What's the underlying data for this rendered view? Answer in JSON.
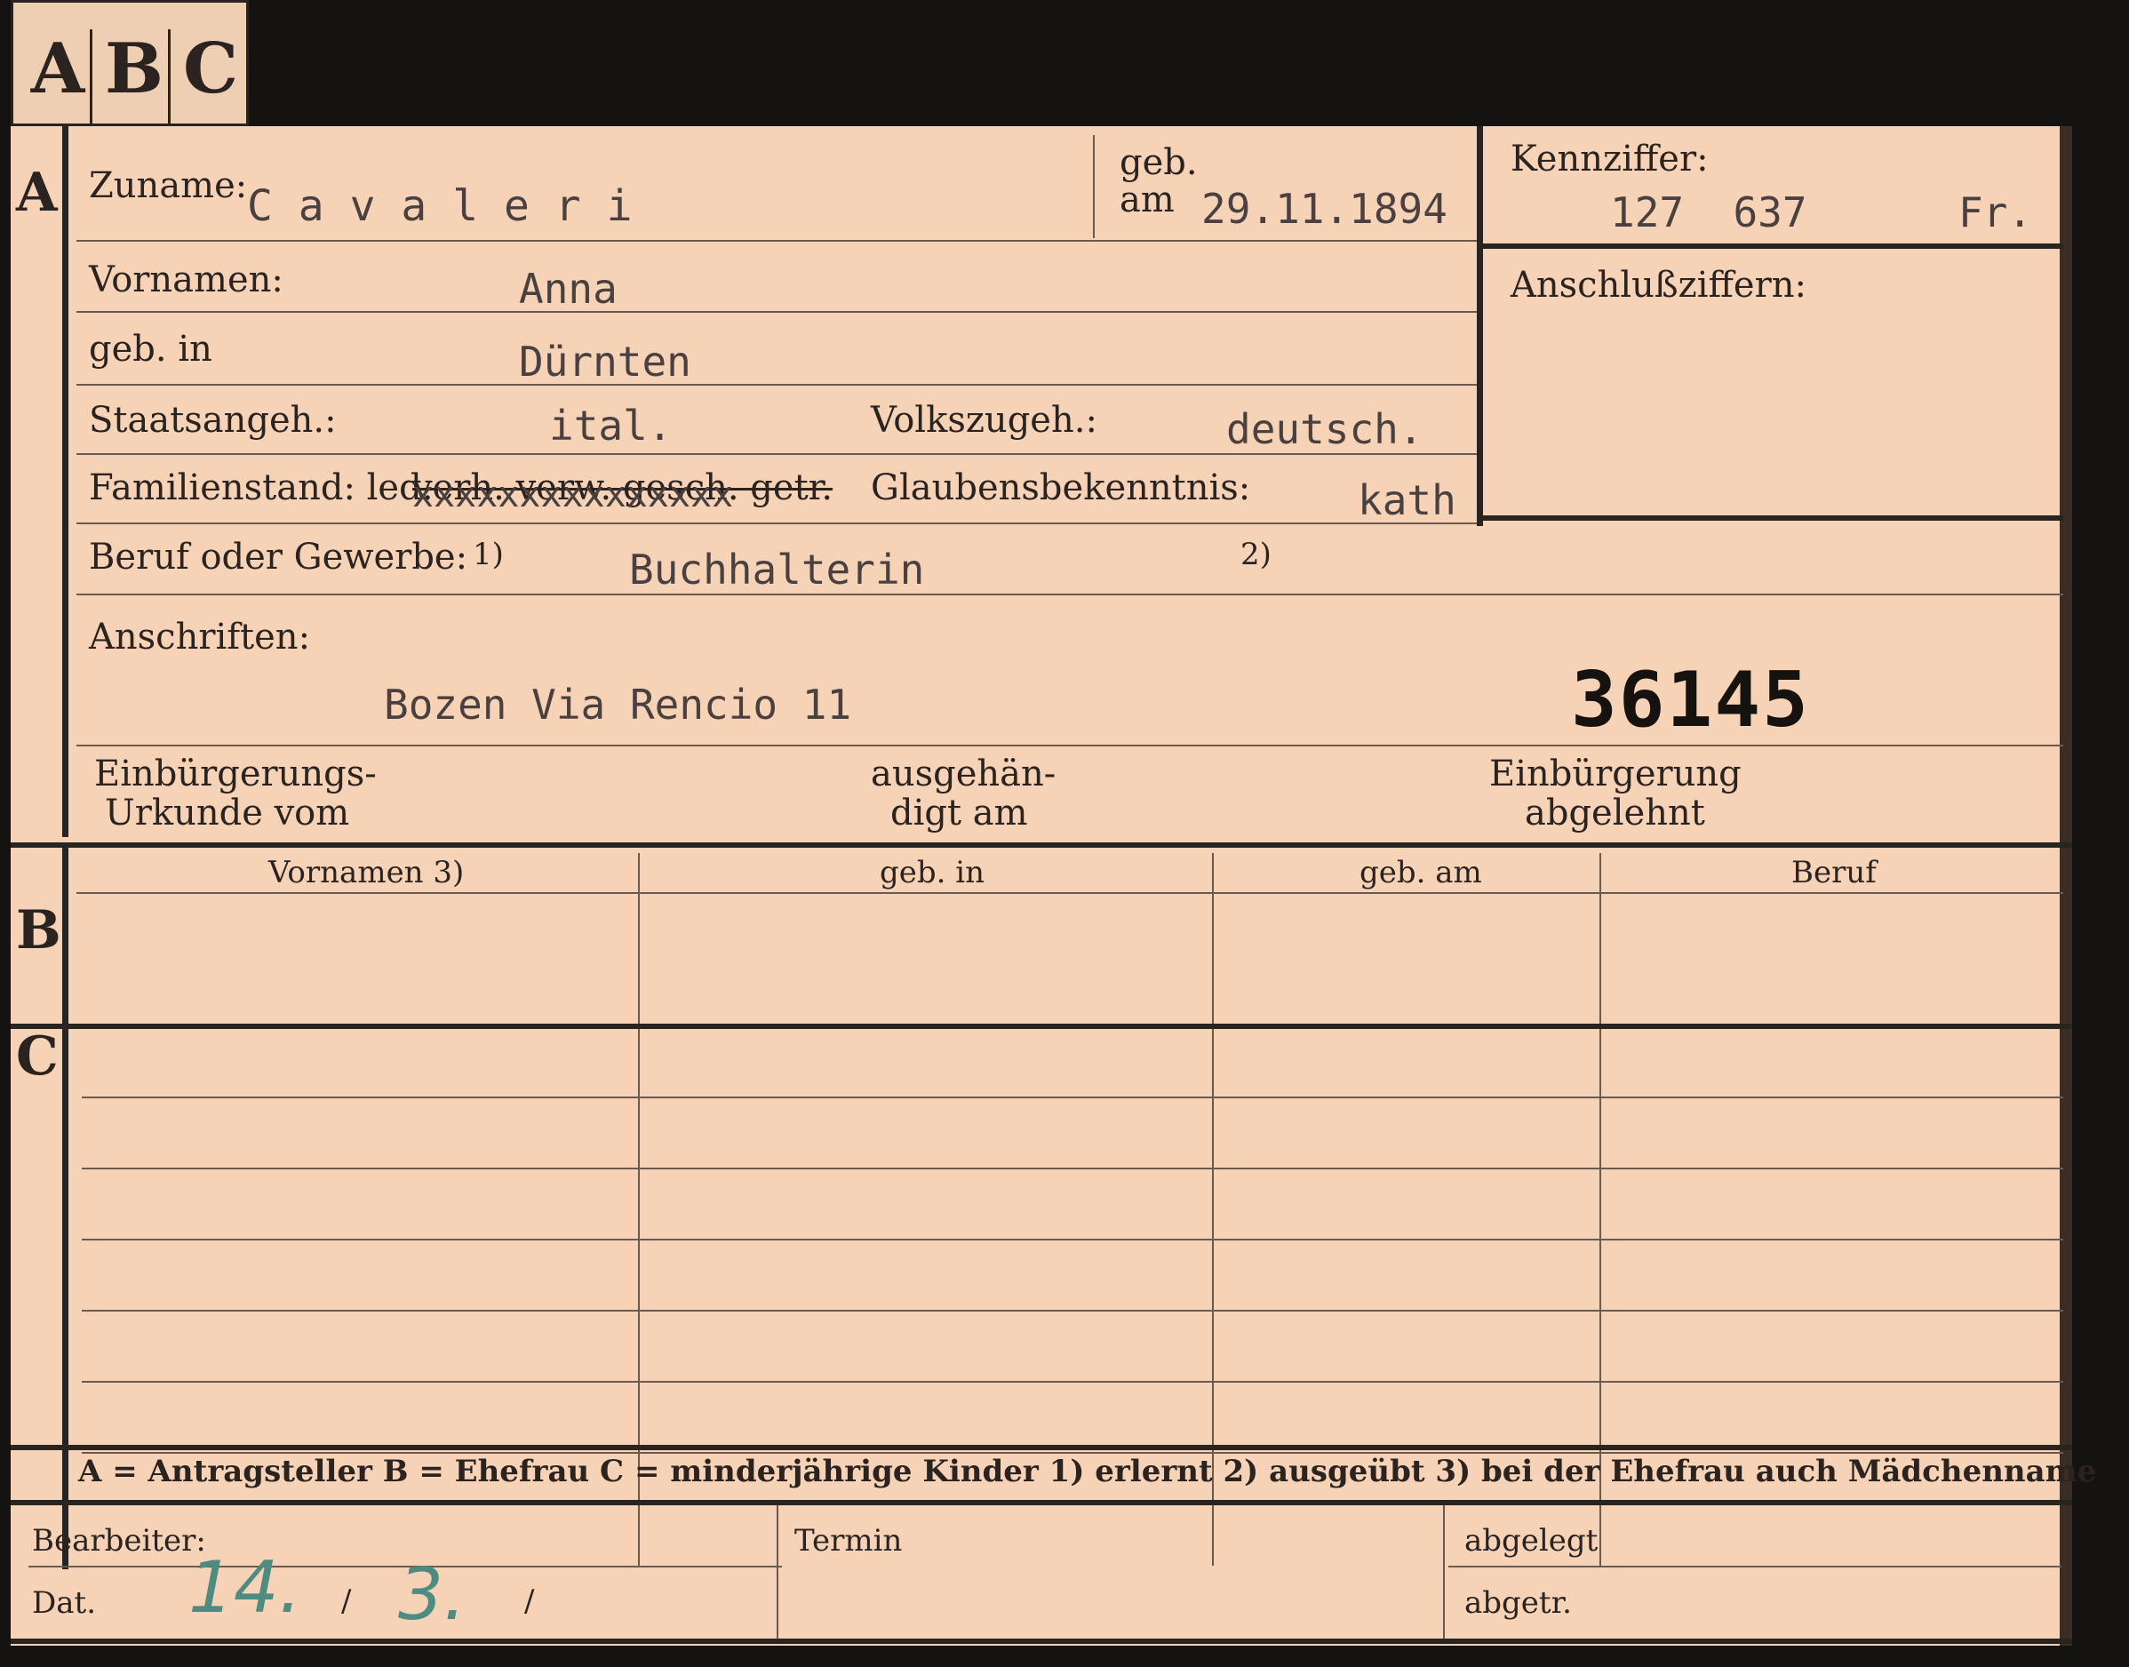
{
  "tabs": [
    "A",
    "B",
    "C"
  ],
  "section_a": {
    "marker": "A",
    "zuname_label": "Zuname:",
    "zuname_value": "C a v a l e r i",
    "geb_label": "geb.",
    "am_label": "am",
    "geb_am_value": "29.11.1894",
    "kennziffer_label": "Kennziffer:",
    "kennziffer_number": "127  637",
    "kennziffer_suffix": "Fr.",
    "anschluss_label": "Anschlußziffern:",
    "vornamen_label": "Vornamen:",
    "vornamen_value": "Anna",
    "gebin_label": "geb. in",
    "gebin_value": "Dürnten",
    "staats_label": "Staatsangeh.:",
    "staats_value": "ital.",
    "volks_label": "Volkszugeh.:",
    "volks_value": "deutsch.",
    "familien_label": "Familienstand: led.",
    "familien_struck": "verh. verw. gesch. getr.",
    "familien_x": "xxxxxxxxxxxxxxx",
    "glauben_label": "Glaubensbekenntnis:",
    "glauben_value": "kath",
    "beruf_label": "Beruf oder Gewerbe:",
    "beruf_note1": "1)",
    "beruf_value": "Buchhalterin",
    "beruf_note2": "2)",
    "anschriften_label": "Anschriften:",
    "anschriften_value": "Bozen Via Rencio 11",
    "stamp_number": "36145",
    "einb_label_1": "Einbürgerungs-",
    "einb_label_2": "Urkunde vom",
    "ausgeh_label_1": "ausgehän-",
    "ausgeh_label_2": "digt am",
    "abgel_label_1": "Einbürgerung",
    "abgel_label_2": "abgelehnt"
  },
  "section_b": {
    "marker": "B",
    "columns": [
      "Vornamen 3)",
      "geb. in",
      "geb. am",
      "Beruf"
    ]
  },
  "section_c": {
    "marker": "C"
  },
  "legend": "A = Antragsteller   B = Ehefrau   C = minderjährige Kinder   1) erlernt   2) ausgeübt   3) bei der Ehefrau auch Mädchenname",
  "footer": {
    "bearbeiter_label": "Bearbeiter:",
    "dat_label": "Dat.",
    "dat_day": "14.",
    "dat_sep1": "/",
    "dat_month": "3.",
    "dat_sep2": "/",
    "termin_label": "Termin",
    "abgelegt_label": "abgelegt",
    "abgetr_label": "abgetr."
  }
}
